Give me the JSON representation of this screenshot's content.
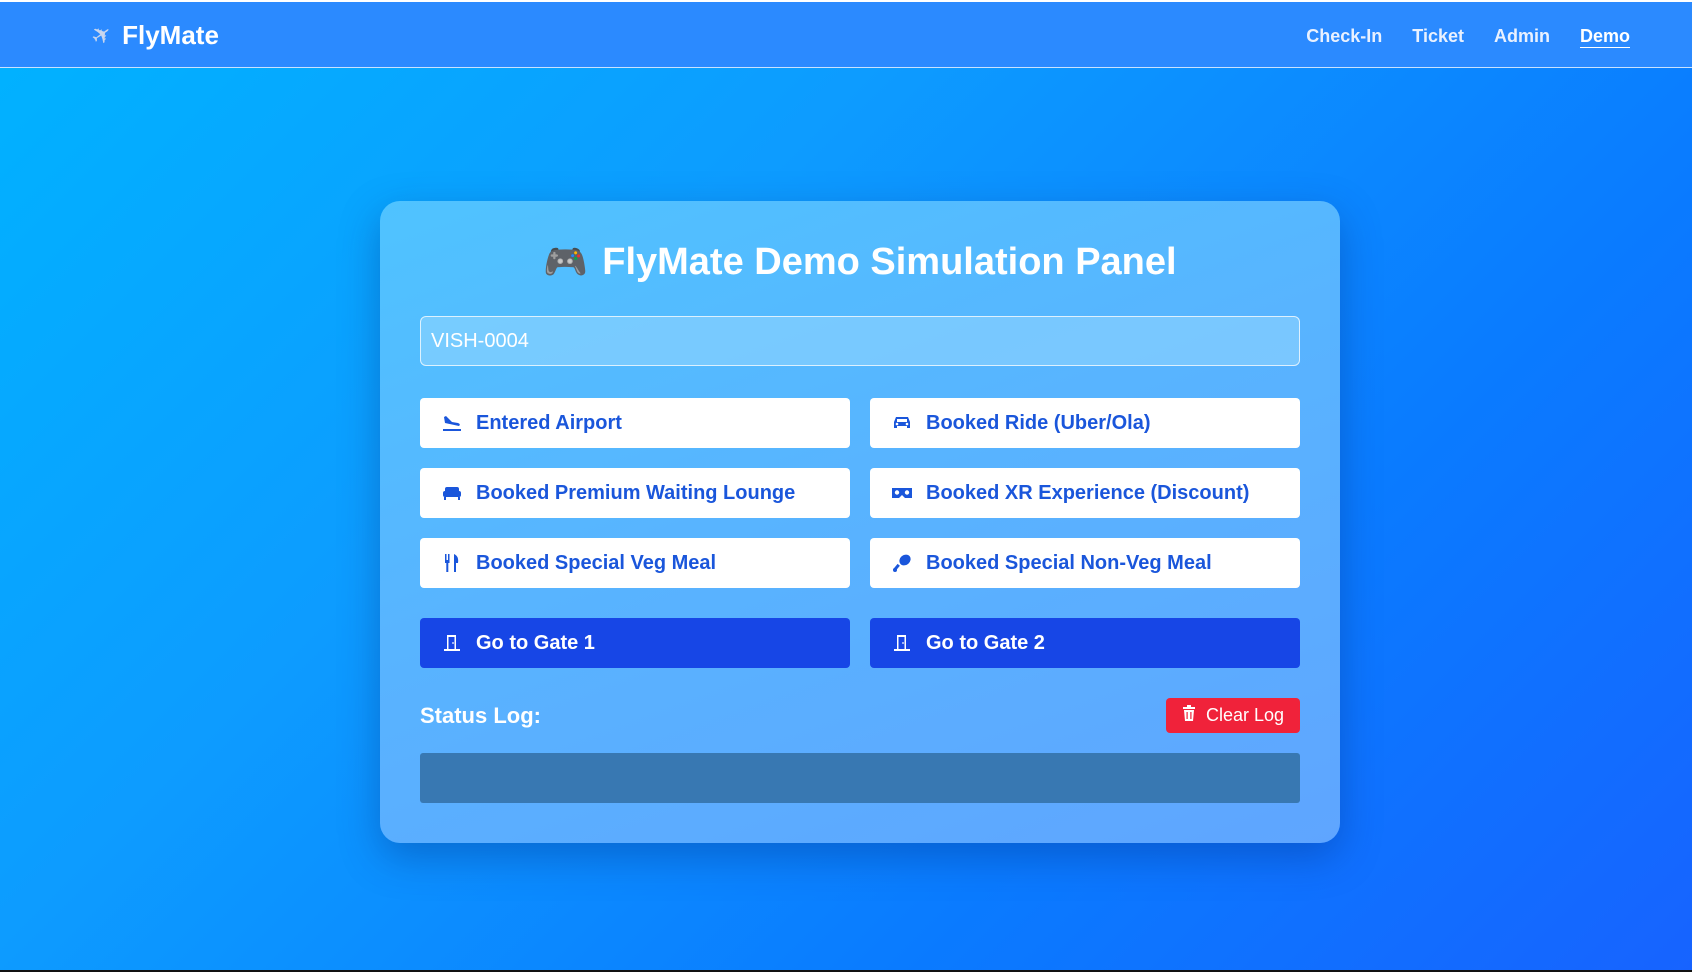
{
  "brand": {
    "name": "FlyMate",
    "icon": "airplane-icon"
  },
  "nav": {
    "links": [
      {
        "label": "Check-In"
      },
      {
        "label": "Ticket"
      },
      {
        "label": "Admin"
      },
      {
        "label": "Demo",
        "active": true
      }
    ]
  },
  "panel": {
    "title": "FlyMate Demo Simulation Panel",
    "title_icon": "gamepad-icon",
    "passenger_id_value": "VISH-0004",
    "event_buttons": [
      {
        "label": "Entered Airport",
        "icon": "plane-landing-icon"
      },
      {
        "label": "Booked Ride (Uber/Ola)",
        "icon": "car-icon"
      },
      {
        "label": "Booked Premium Waiting Lounge",
        "icon": "couch-icon"
      },
      {
        "label": "Booked XR Experience (Discount)",
        "icon": "vr-headset-icon"
      },
      {
        "label": "Booked Special Veg Meal",
        "icon": "utensils-icon"
      },
      {
        "label": "Booked Special Non-Veg Meal",
        "icon": "drumstick-icon"
      }
    ],
    "gate_buttons": [
      {
        "label": "Go to Gate 1",
        "icon": "door-icon"
      },
      {
        "label": "Go to Gate 2",
        "icon": "door-icon"
      }
    ],
    "status_log_label": "Status Log:",
    "clear_log_label": "Clear Log",
    "clear_log_icon": "trash-icon"
  },
  "colors": {
    "accent": "#1746e6",
    "danger": "#f0223a",
    "button_text": "#1a56db"
  }
}
